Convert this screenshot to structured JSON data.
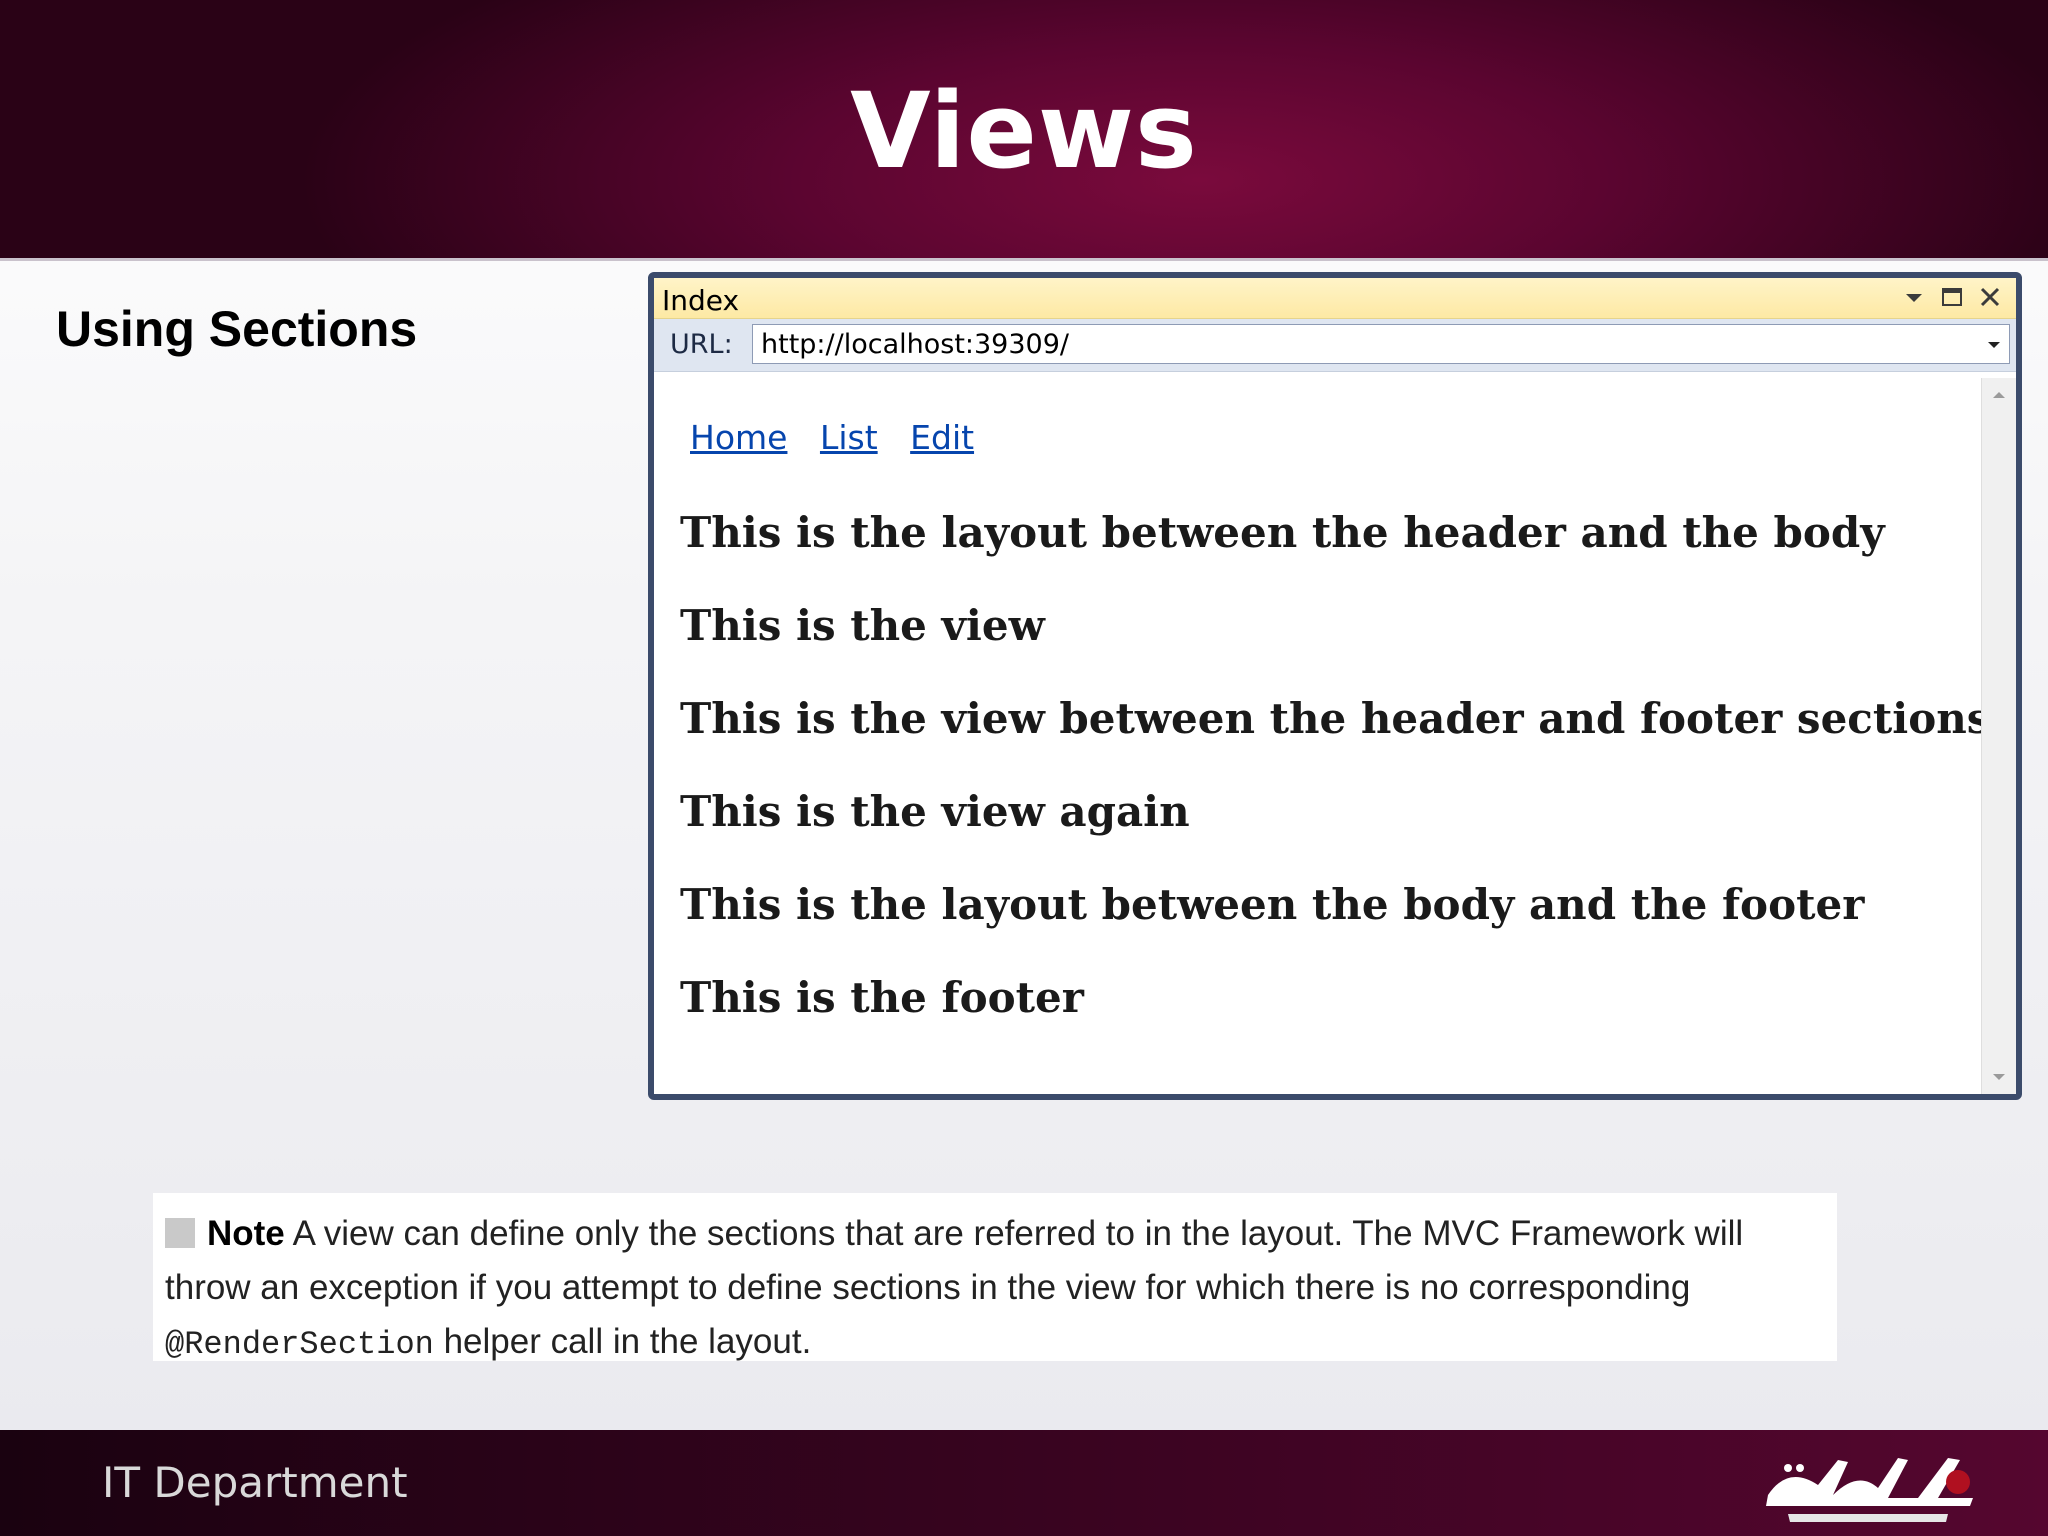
{
  "slide": {
    "title": "Views",
    "subtitle": "Using Sections"
  },
  "browser": {
    "window_title": "Index",
    "url_label": "URL:",
    "url_value": "http://localhost:39309/",
    "nav_links": [
      "Home",
      "List",
      "Edit"
    ],
    "lines": [
      "This is the layout between the header and the body",
      "This is the view",
      "This is the view between the header and footer sections",
      "This is the view again",
      "This is the layout between the body and the footer",
      "This is the footer"
    ]
  },
  "note": {
    "label": "Note",
    "text_part1": " A view can define only the sections that are referred to in the layout. The MVC Framework will throw an exception if you attempt to define sections in the view for which there is no corresponding ",
    "code": "@RenderSection",
    "text_part2": " helper call in the layout."
  },
  "footer": {
    "department": "IT Department"
  },
  "colors": {
    "header_bg": "#5b0530",
    "window_border": "#3b4b6b",
    "titlebar_bg": "#fde9a4",
    "link": "#0645ad"
  },
  "icons": [
    "dropdown-arrow-icon",
    "maximize-icon",
    "close-icon",
    "scroll-up-icon",
    "scroll-down-icon",
    "logo"
  ]
}
